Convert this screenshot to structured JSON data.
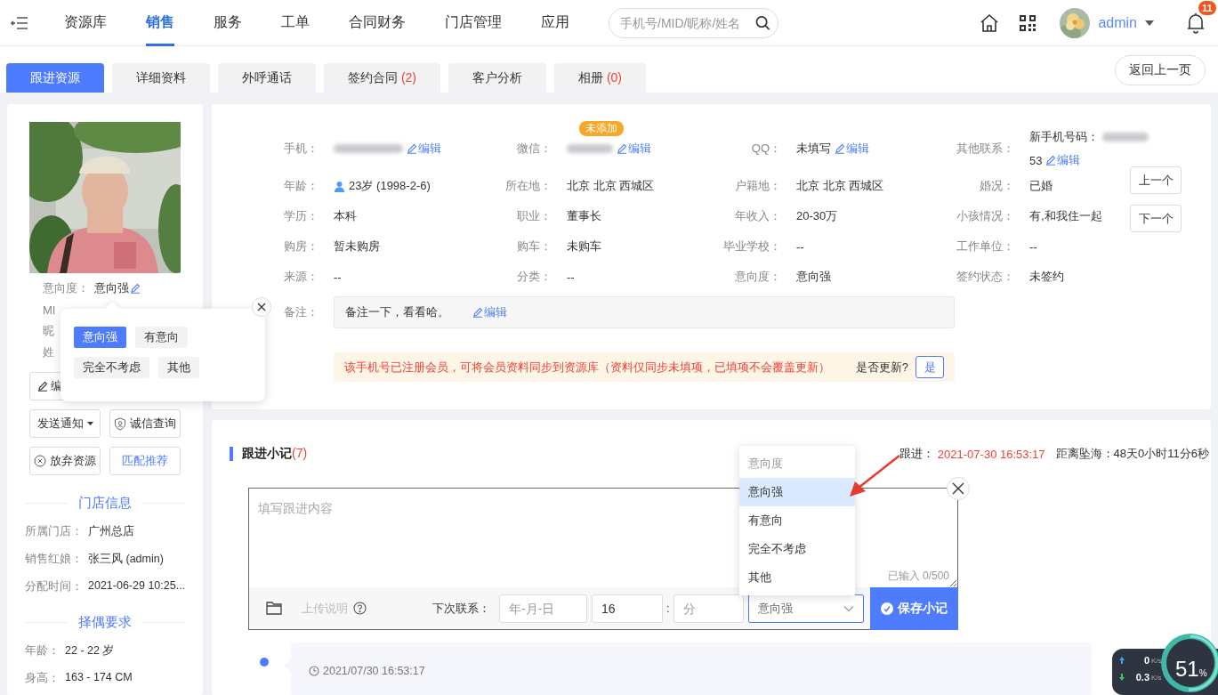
{
  "nav": {
    "items": [
      {
        "label": "资源库",
        "selected": false
      },
      {
        "label": "销售",
        "selected": true
      },
      {
        "label": "服务",
        "selected": false
      },
      {
        "label": "工单",
        "selected": false
      },
      {
        "label": "合同财务",
        "selected": false
      },
      {
        "label": "门店管理",
        "selected": false
      },
      {
        "label": "应用",
        "selected": false
      }
    ],
    "search": {
      "placeholder": "手机号/MID/昵称/姓名"
    },
    "user": {
      "name": "admin"
    },
    "notifications": {
      "count": "11"
    }
  },
  "tabs": [
    {
      "label": "跟进资源",
      "selected": true
    },
    {
      "label": "详细资料",
      "selected": false
    },
    {
      "label": "外呼通话",
      "selected": false
    },
    {
      "label": "签约合同",
      "count": "(2)",
      "selected": false
    },
    {
      "label": "客户分析",
      "selected": false
    },
    {
      "label": "相册",
      "count": "(0)",
      "selected": false
    }
  ],
  "back_button": "返回上一页",
  "profile": {
    "intent": {
      "label": "意向度：",
      "value": "意向强"
    },
    "partial_labels": [
      "MI",
      "昵",
      "姓"
    ],
    "edit_button": "编",
    "buttons": [
      {
        "kind": "dropdown",
        "label": "发送通知"
      },
      {
        "kind": "shield",
        "label": "诚信查询"
      },
      {
        "kind": "cancel",
        "label": "放弃资源"
      },
      {
        "kind": "link",
        "label": "匹配推荐"
      }
    ],
    "sections": [
      {
        "title": "门店信息",
        "rows": [
          {
            "label": "所属门店：",
            "value": "广州总店"
          },
          {
            "label": "销售红娘：",
            "value": "张三风 (admin)"
          },
          {
            "label": "分配时间：",
            "value": "2021-06-29 10:25..."
          }
        ]
      },
      {
        "title": "择偶要求",
        "rows": [
          {
            "label": "年龄：",
            "value": "22 - 22 岁"
          },
          {
            "label": "身高：",
            "value": "163 - 174 CM"
          }
        ]
      }
    ]
  },
  "intent_popover": {
    "options": [
      {
        "label": "意向强",
        "selected": true
      },
      {
        "label": "有意向",
        "selected": false
      },
      {
        "label": "完全不考虑",
        "selected": false
      },
      {
        "label": "其他",
        "selected": false
      }
    ]
  },
  "info": {
    "fields": [
      {
        "kind": "redacted_edit",
        "label": "手机：",
        "edit": "编辑"
      },
      {
        "kind": "redacted_edit",
        "label": "微信：",
        "edit": "编辑",
        "badge": "未添加"
      },
      {
        "kind": "value_edit",
        "label": "QQ：",
        "value": "未填写",
        "edit": "编辑"
      },
      {
        "kind": "contact",
        "label": "其他联系：",
        "prefix": "新手机号码：",
        "suffix": "53",
        "edit": "编辑"
      },
      {
        "kind": "person",
        "label": "年龄：",
        "value": "23岁 (1998-2-6)"
      },
      {
        "kind": "plain",
        "label": "所在地：",
        "value": "北京 北京 西城区"
      },
      {
        "kind": "plain",
        "label": "户籍地：",
        "value": "北京 北京 西城区"
      },
      {
        "kind": "plain",
        "label": "婚况：",
        "value": "已婚"
      },
      {
        "kind": "plain",
        "label": "学历：",
        "value": "本科"
      },
      {
        "kind": "plain",
        "label": "职业：",
        "value": "董事长"
      },
      {
        "kind": "plain",
        "label": "年收入：",
        "value": "20-30万"
      },
      {
        "kind": "plain",
        "label": "小孩情况：",
        "value": "有,和我住一起"
      },
      {
        "kind": "plain",
        "label": "购房：",
        "value": "暂未购房"
      },
      {
        "kind": "plain",
        "label": "购车：",
        "value": "未购车"
      },
      {
        "kind": "plain",
        "label": "毕业学校：",
        "value": "--"
      },
      {
        "kind": "plain",
        "label": "工作单位：",
        "value": "--"
      },
      {
        "kind": "plain",
        "label": "来源：",
        "value": "--"
      },
      {
        "kind": "plain",
        "label": "分类：",
        "value": "--"
      },
      {
        "kind": "plain",
        "label": "意向度：",
        "value": "意向强"
      },
      {
        "kind": "plain",
        "label": "签约状态：",
        "value": "未签约"
      }
    ],
    "side_buttons": [
      "上一个",
      "下一个"
    ],
    "remark": {
      "label": "备注：",
      "value": "备注一下，看看哈。",
      "edit": "编辑"
    },
    "notice": {
      "message": "该手机号已注册会员，可将会员资料同步到资源库（资料仅同步未填项，已填项不会覆盖更新）",
      "question": "是否更新?",
      "button": "是"
    }
  },
  "notes": {
    "title": "跟进小记",
    "count": "(7)",
    "last_label": "跟进：",
    "last_time": "2021-07-30 16:53:17",
    "countdown_label": "距离坠海：",
    "countdown": "48天0小时11分6秒",
    "editor": {
      "placeholder": "填写跟进内容",
      "counter": "已输入 0/500"
    },
    "upload_label": "上传说明",
    "next_label": "下次联系：",
    "date": {
      "placeholder": "年-月-日"
    },
    "hour": {
      "value": "16"
    },
    "separator": ":",
    "minute": {
      "placeholder": "分"
    },
    "intent_select": {
      "value": "意向强",
      "expanded": true,
      "options": [
        {
          "kind": "placeholder",
          "label": "意向度",
          "selected": false
        },
        {
          "kind": "option",
          "label": "意向强",
          "selected": true
        },
        {
          "kind": "option",
          "label": "有意向",
          "selected": false
        },
        {
          "kind": "option",
          "label": "完全不考虑",
          "selected": false
        },
        {
          "kind": "option",
          "label": "其他",
          "selected": false
        }
      ]
    },
    "save_button": "保存小记",
    "timeline": [
      {
        "time": "2021/07/30 16:53:17"
      }
    ]
  },
  "net_widget": {
    "upload": "0",
    "upload_unit": "K/s",
    "download": "0.3",
    "download_unit": "K/s",
    "percent": "51",
    "percent_sign": "%",
    "level": 0.51
  }
}
